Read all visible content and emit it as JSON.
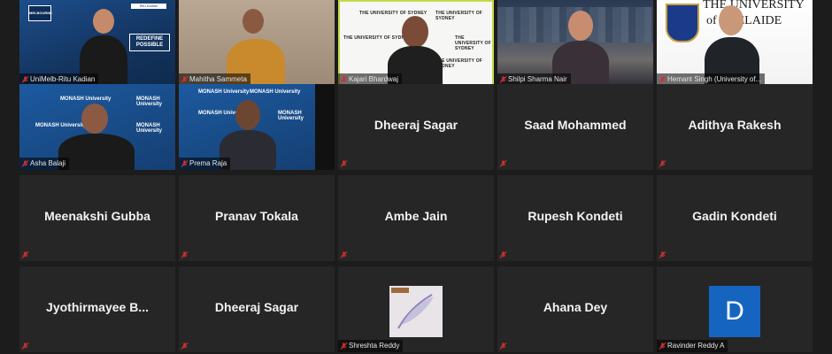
{
  "tiles": [
    {
      "name": "UniMelb-Ritu Kadian",
      "kind": "video",
      "bg": "blue"
    },
    {
      "name": "Mahitha Sammeta",
      "kind": "video",
      "bg": "beige"
    },
    {
      "name": "Kajari Bhardwaj",
      "kind": "video",
      "bg": "white",
      "active": true
    },
    {
      "name": "Shilpi Sharma Nair",
      "kind": "video",
      "bg": "city"
    },
    {
      "name": "Hemant Singh (University of...",
      "kind": "video",
      "bg": "adelaide"
    },
    {
      "name": "Asha Balaji",
      "kind": "video",
      "bg": "monash"
    },
    {
      "name": "Prema Raja",
      "kind": "video",
      "bg": "monash"
    },
    {
      "name": "Dheeraj Sagar",
      "kind": "text"
    },
    {
      "name": "Saad Mohammed",
      "kind": "text"
    },
    {
      "name": "Adithya Rakesh",
      "kind": "text"
    },
    {
      "name": "Meenakshi Gubba",
      "kind": "text"
    },
    {
      "name": "Pranav Tokala",
      "kind": "text"
    },
    {
      "name": "Ambe Jain",
      "kind": "text"
    },
    {
      "name": "Rupesh Kondeti",
      "kind": "text"
    },
    {
      "name": "Gadin Kondeti",
      "kind": "text"
    },
    {
      "name": "Jyothirmayee  B...",
      "kind": "text"
    },
    {
      "name": "Dheeraj Sagar",
      "kind": "text"
    },
    {
      "name": "Shreshta Reddy",
      "kind": "image"
    },
    {
      "name": "Ahana Dey",
      "kind": "text"
    },
    {
      "name": "Ravinder Reddy A",
      "kind": "avatar",
      "initial": "D"
    }
  ],
  "logos": {
    "melbourne": "MELBOURNE",
    "redefine": "REDEFINE POSSIBLE",
    "ritu_card": "Ritu Kadian",
    "sydney": "THE UNIVERSITY OF SYDNEY",
    "adelaide_line1": "THE UNIVERSITY",
    "adelaide_line2": "of ADELAIDE",
    "monash": "MONASH University"
  },
  "colors": {
    "active_border": "#c7d84a",
    "mute_red": "#d32f2f",
    "avatar_blue": "#1565c0"
  }
}
